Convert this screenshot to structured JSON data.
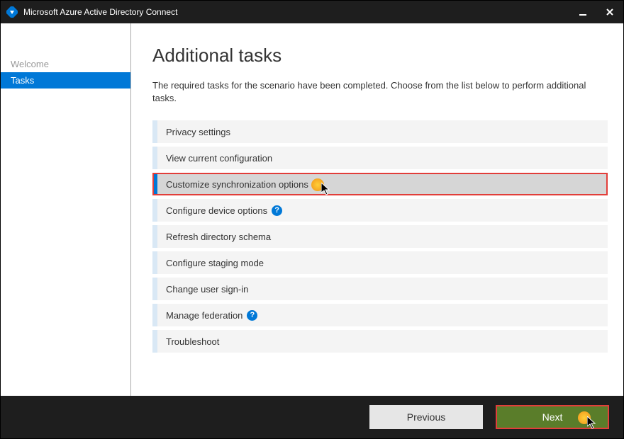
{
  "titlebar": {
    "title": "Microsoft Azure Active Directory Connect"
  },
  "sidebar": {
    "items": [
      {
        "label": "Welcome",
        "active": false
      },
      {
        "label": "Tasks",
        "active": true
      }
    ]
  },
  "main": {
    "title": "Additional tasks",
    "description": "The required tasks for the scenario have been completed. Choose from the list below to perform additional tasks.",
    "tasks": [
      {
        "label": "Privacy settings",
        "help": false,
        "selected": false
      },
      {
        "label": "View current configuration",
        "help": false,
        "selected": false
      },
      {
        "label": "Customize synchronization options",
        "help": false,
        "selected": true
      },
      {
        "label": "Configure device options",
        "help": true,
        "selected": false
      },
      {
        "label": "Refresh directory schema",
        "help": false,
        "selected": false
      },
      {
        "label": "Configure staging mode",
        "help": false,
        "selected": false
      },
      {
        "label": "Change user sign-in",
        "help": false,
        "selected": false
      },
      {
        "label": "Manage federation",
        "help": true,
        "selected": false
      },
      {
        "label": "Troubleshoot",
        "help": false,
        "selected": false
      }
    ]
  },
  "footer": {
    "previous_label": "Previous",
    "next_label": "Next"
  }
}
